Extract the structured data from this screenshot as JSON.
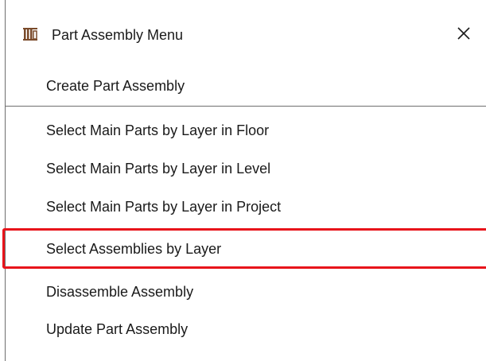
{
  "window": {
    "title": "Part Assembly Menu",
    "close_symbol": "✕",
    "app_icon": "columns-icon"
  },
  "menu": {
    "items": [
      {
        "label": "Create Part Assembly"
      },
      {
        "label": "Select Main Parts by Layer in Floor"
      },
      {
        "label": "Select Main Parts by Layer in Level"
      },
      {
        "label": "Select Main Parts by Layer in Project"
      },
      {
        "label": "Select Assemblies by Layer"
      },
      {
        "label": "Disassemble Assembly"
      },
      {
        "label": "Update Part Assembly"
      }
    ]
  },
  "colors": {
    "highlight_border": "#e8141b",
    "separator": "#6f6f6f",
    "icon_brown": "#7a4a2a"
  }
}
